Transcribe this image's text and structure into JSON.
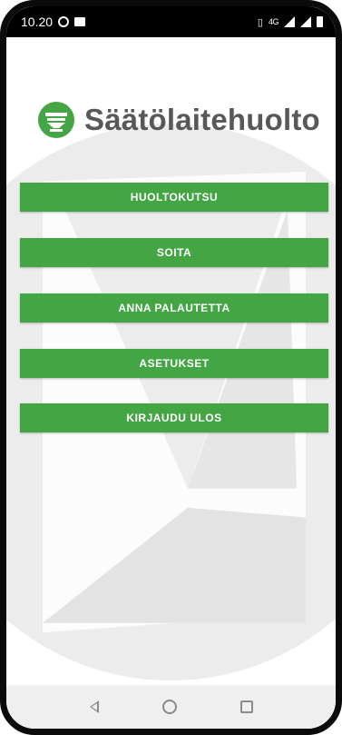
{
  "status_bar": {
    "time": "10.20",
    "network_label": "4G"
  },
  "app": {
    "name": "Säätölaitehuolto",
    "brand_color": "#43a544",
    "logo_color": "#585858"
  },
  "menu": {
    "items": [
      {
        "label": "HUOLTOKUTSU"
      },
      {
        "label": "SOITA"
      },
      {
        "label": "ANNA PALAUTETTA"
      },
      {
        "label": "ASETUKSET"
      },
      {
        "label": "KIRJAUDU ULOS"
      }
    ]
  },
  "icons": {
    "status_left": [
      "whatsapp-icon",
      "image-icon"
    ],
    "status_right": [
      "vibrate-icon",
      "network-icon",
      "signal-icon",
      "battery-icon"
    ],
    "navigation": [
      "back-icon",
      "home-icon",
      "recents-icon"
    ]
  }
}
